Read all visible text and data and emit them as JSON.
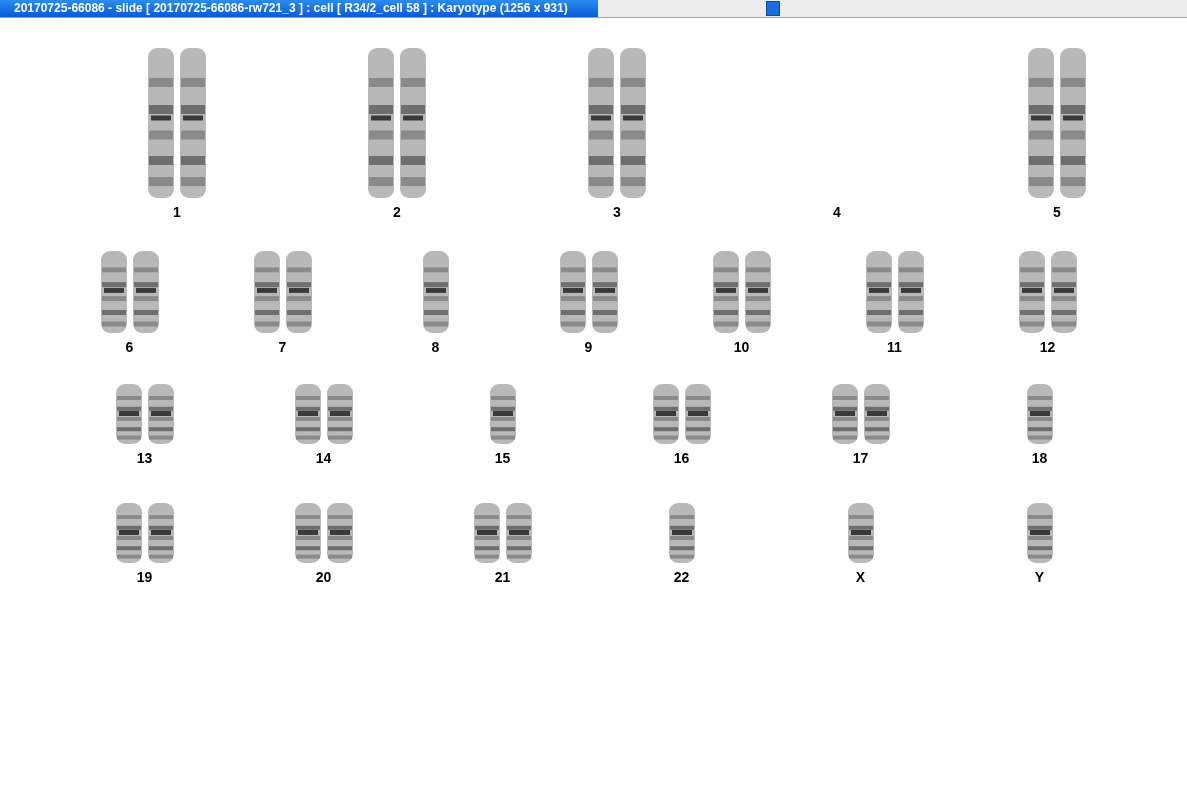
{
  "window": {
    "title": "20170725-66086 - slide [ 20170725-66086-rw721_3 ] : cell [ R34/2_cell 58 ] : Karyotype  (1256 x 931)"
  },
  "karyotype": {
    "rows": [
      [
        {
          "label": "1",
          "kind": "pair"
        },
        {
          "label": "2",
          "kind": "pair"
        },
        {
          "label": "3",
          "kind": "pair"
        },
        {
          "label": "4",
          "kind": "empty"
        },
        {
          "label": "5",
          "kind": "pair"
        }
      ],
      [
        {
          "label": "6",
          "kind": "pair"
        },
        {
          "label": "7",
          "kind": "pair"
        },
        {
          "label": "8",
          "kind": "single"
        },
        {
          "label": "9",
          "kind": "pair"
        },
        {
          "label": "10",
          "kind": "pair"
        },
        {
          "label": "11",
          "kind": "pair"
        },
        {
          "label": "12",
          "kind": "pair"
        }
      ],
      [
        {
          "label": "13",
          "kind": "pair"
        },
        {
          "label": "14",
          "kind": "pair"
        },
        {
          "label": "15",
          "kind": "single"
        },
        {
          "label": "16",
          "kind": "pair"
        },
        {
          "label": "17",
          "kind": "pair"
        },
        {
          "label": "18",
          "kind": "single"
        }
      ],
      [
        {
          "label": "19",
          "kind": "pair"
        },
        {
          "label": "20",
          "kind": "pair"
        },
        {
          "label": "21",
          "kind": "pair"
        },
        {
          "label": "22",
          "kind": "single"
        },
        {
          "label": "X",
          "kind": "single"
        },
        {
          "label": "Y",
          "kind": "single"
        }
      ]
    ]
  }
}
